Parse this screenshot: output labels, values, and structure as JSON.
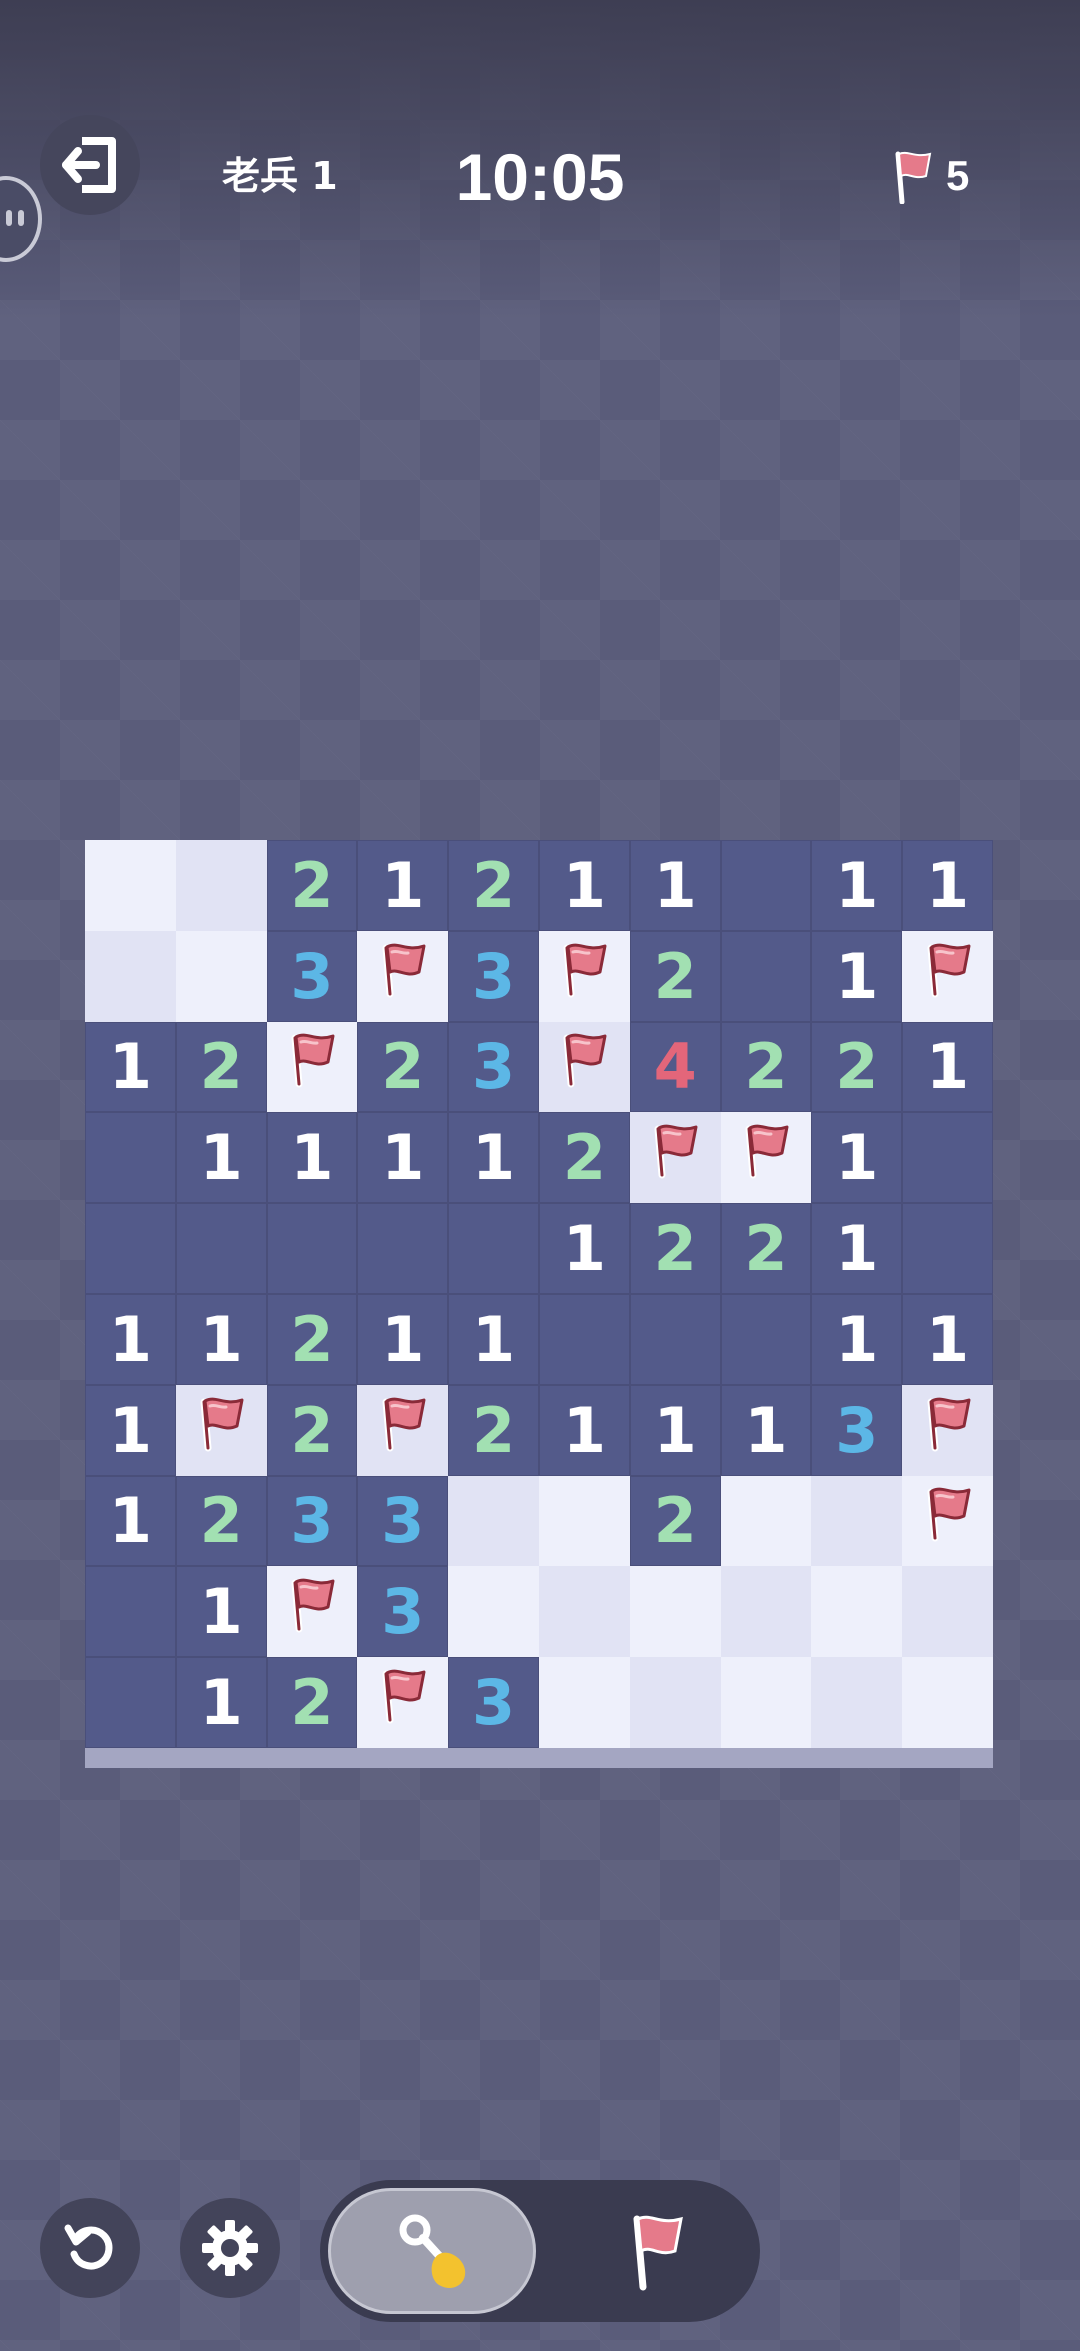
{
  "header": {
    "opponent_name": "老兵 1",
    "timer": "10:05",
    "flags_remaining": "5"
  },
  "board": {
    "rows": [
      [
        "",
        "",
        "2",
        "1",
        "2",
        "1",
        "1",
        ".",
        "1",
        "1"
      ],
      [
        "",
        "",
        "3",
        "F",
        "3",
        "F",
        "2",
        ".",
        "1",
        "F"
      ],
      [
        "1",
        "2",
        "F",
        "2",
        "3",
        "F",
        "4",
        "2",
        "2",
        "1"
      ],
      [
        ".",
        "1",
        "1",
        "1",
        "1",
        "2",
        "F",
        "F",
        "1",
        "."
      ],
      [
        ".",
        ".",
        ".",
        ".",
        ".",
        "1",
        "2",
        "2",
        "1",
        "."
      ],
      [
        "1",
        "1",
        "2",
        "1",
        "1",
        ".",
        ".",
        ".",
        "1",
        "1"
      ],
      [
        "1",
        "F",
        "2",
        "F",
        "2",
        "1",
        "1",
        "1",
        "3",
        "F"
      ],
      [
        "1",
        "2",
        "3",
        "3",
        "",
        "",
        "2",
        "",
        "",
        "F"
      ],
      [
        ".",
        "1",
        "F",
        "3",
        "",
        "",
        "",
        "",
        "",
        ""
      ],
      [
        ".",
        "1",
        "2",
        "F",
        "3",
        "",
        "",
        "",
        "",
        ""
      ]
    ]
  },
  "icons": {
    "exit": "exit-icon",
    "chat": "chat-icon",
    "flag": "flag-icon",
    "undo": "undo-icon",
    "settings": "gear-icon",
    "dig": "shovel-icon"
  },
  "colors": {
    "revealed_cell": "#535a8a",
    "hidden_cell_light": "#eef0fb",
    "hidden_cell_alt": "#e1e3f4",
    "number_1": "#ffffff",
    "number_2": "#a2e0b2",
    "number_3": "#5cb7e6",
    "number_4": "#e3667a",
    "flag": "#e57a8a"
  }
}
